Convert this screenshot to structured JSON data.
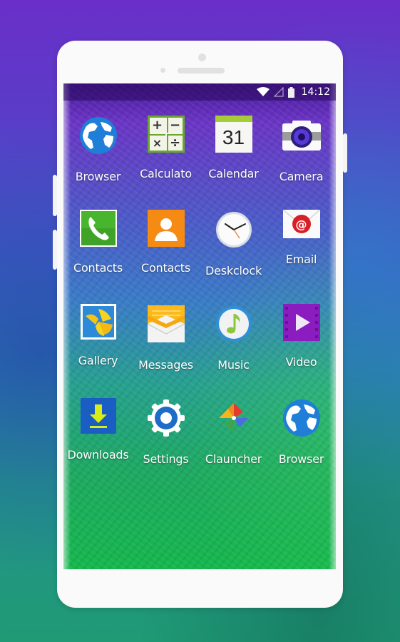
{
  "status_bar": {
    "wifi_icon": "wifi-icon",
    "signal_icon": "signal-icon",
    "battery_icon": "battery-icon",
    "time": "14:12"
  },
  "apps": [
    {
      "label": "Browser",
      "icon": "globe-icon"
    },
    {
      "label": "Calculato",
      "icon": "calculator-icon"
    },
    {
      "label": "Calendar",
      "icon": "calendar-icon",
      "date": "31"
    },
    {
      "label": "Camera",
      "icon": "camera-icon"
    },
    {
      "label": "Contacts",
      "icon": "phone-icon"
    },
    {
      "label": "Contacts",
      "icon": "contact-person-icon"
    },
    {
      "label": "Deskclock",
      "icon": "clock-icon"
    },
    {
      "label": "Email",
      "icon": "email-icon",
      "symbol": "@"
    },
    {
      "label": "Gallery",
      "icon": "gallery-icon"
    },
    {
      "label": "Messages",
      "icon": "envelope-icon"
    },
    {
      "label": "Music",
      "icon": "music-note-icon"
    },
    {
      "label": "Video",
      "icon": "video-play-icon"
    },
    {
      "label": "Downloads",
      "icon": "download-icon"
    },
    {
      "label": "Settings",
      "icon": "gear-icon"
    },
    {
      "label": "Clauncher",
      "icon": "pinwheel-icon"
    },
    {
      "label": "Browser",
      "icon": "globe-icon"
    }
  ],
  "calculator_symbols": [
    "+",
    "−",
    "×",
    "÷"
  ]
}
